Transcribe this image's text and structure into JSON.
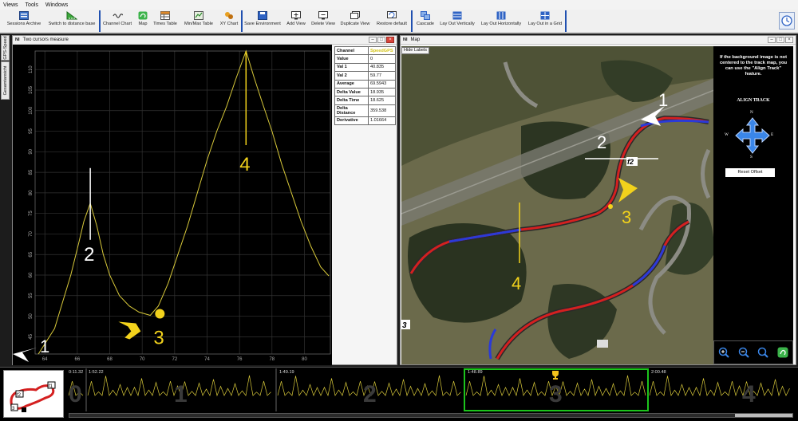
{
  "menu": [
    "Views",
    "Tools",
    "Windows"
  ],
  "toolbar": {
    "sessions_archive": "Sessions Archive",
    "switch_distance": "Switch to distance base",
    "channel_chart": "Channel Chart",
    "map": "Map",
    "times_table": "Times Table",
    "minmax_table": "Min/Max Table",
    "xy_chart": "XY Chart",
    "save_environment": "Save Environment",
    "add_view": "Add View",
    "delete_view": "Delete View",
    "duplicate_view": "Duplicate View",
    "restore_default": "Restore default",
    "cascade": "Cascade",
    "layout_vertically": "Lay Out Vertically",
    "layout_horizontally": "Lay Out Horizontally",
    "layout_grid": "Lay Out in a Grid"
  },
  "side_tabs": [
    "GPS-Speed",
    "Gesamtansicht"
  ],
  "cursors_panel": {
    "ni": "NI",
    "title": "Two cursors measure",
    "stats": [
      {
        "k": "Channel",
        "v": "SpeedGPS"
      },
      {
        "k": "Value",
        "v": "0"
      },
      {
        "k": "Val 1",
        "v": "40.835"
      },
      {
        "k": "Val 2",
        "v": "59.77"
      },
      {
        "k": "Average",
        "v": "69.5943"
      },
      {
        "k": "Delta Value",
        "v": "18.935"
      },
      {
        "k": "Delta Time",
        "v": "18.625"
      },
      {
        "k": "Delta Distance",
        "v": "359.538"
      },
      {
        "k": "Derivative",
        "v": "1.01664"
      }
    ]
  },
  "map_panel": {
    "ni": "NI",
    "title": "Map",
    "hide_labels": "Hide Labels",
    "align_message": "If the background image is not centered to the track map, you can use the \"Align Track\" feature.",
    "align_title": "ALIGN TRACK",
    "compass": {
      "n": "N",
      "s": "S",
      "e": "E",
      "w": "W"
    },
    "reset_offset": "Reset Offset",
    "marker_labels": [
      "1",
      "2",
      "3",
      "4"
    ],
    "track_labels": [
      "f2",
      "3"
    ]
  },
  "chart_data": {
    "type": "line",
    "x_ticks": [
      64,
      66,
      68,
      70,
      72,
      74,
      76,
      78,
      80
    ],
    "y_ticks": [
      45,
      50,
      55,
      60,
      65,
      70,
      75,
      80,
      85,
      90,
      95,
      100,
      105,
      110
    ],
    "xlim": [
      63.4,
      81.6
    ],
    "ylim": [
      40.8,
      114.5
    ],
    "series": [
      {
        "color": "#d8c93a",
        "points": [
          [
            63.6,
            40.8
          ],
          [
            64.6,
            47
          ],
          [
            65.6,
            60
          ],
          [
            66.1,
            68
          ],
          [
            66.4,
            73
          ],
          [
            66.8,
            77.5
          ],
          [
            67.2,
            72
          ],
          [
            67.6,
            65
          ],
          [
            68.0,
            60
          ],
          [
            68.6,
            55
          ],
          [
            69.2,
            52.5
          ],
          [
            69.8,
            51
          ],
          [
            70.5,
            50.2
          ],
          [
            71.0,
            52.5
          ],
          [
            71.6,
            58
          ],
          [
            72.2,
            65
          ],
          [
            72.8,
            72
          ],
          [
            73.4,
            80
          ],
          [
            74.0,
            88
          ],
          [
            74.6,
            95
          ],
          [
            75.2,
            101
          ],
          [
            75.8,
            108
          ],
          [
            76.4,
            114.5
          ],
          [
            76.9,
            108
          ],
          [
            77.4,
            102
          ],
          [
            78.0,
            95
          ],
          [
            78.6,
            87
          ],
          [
            79.2,
            80
          ],
          [
            79.8,
            73
          ],
          [
            80.4,
            67
          ],
          [
            81.0,
            62
          ],
          [
            81.5,
            59.8
          ]
        ]
      }
    ],
    "markers": [
      {
        "label": "1",
        "color": "#ffffff"
      },
      {
        "label": "2",
        "color": "#ffffff"
      },
      {
        "label": "3",
        "color": "#f2d21c"
      },
      {
        "label": "4",
        "color": "#f2d21c"
      }
    ]
  },
  "session_strip": {
    "lap_times": [
      "0:11.32",
      "1:52.22",
      "1:49.19",
      "1:48.89",
      "2:00.48"
    ],
    "lap_numbers": [
      "0",
      "1",
      "2",
      "3",
      "4"
    ],
    "minimap_labels": [
      "f2",
      "f1",
      "3"
    ]
  }
}
